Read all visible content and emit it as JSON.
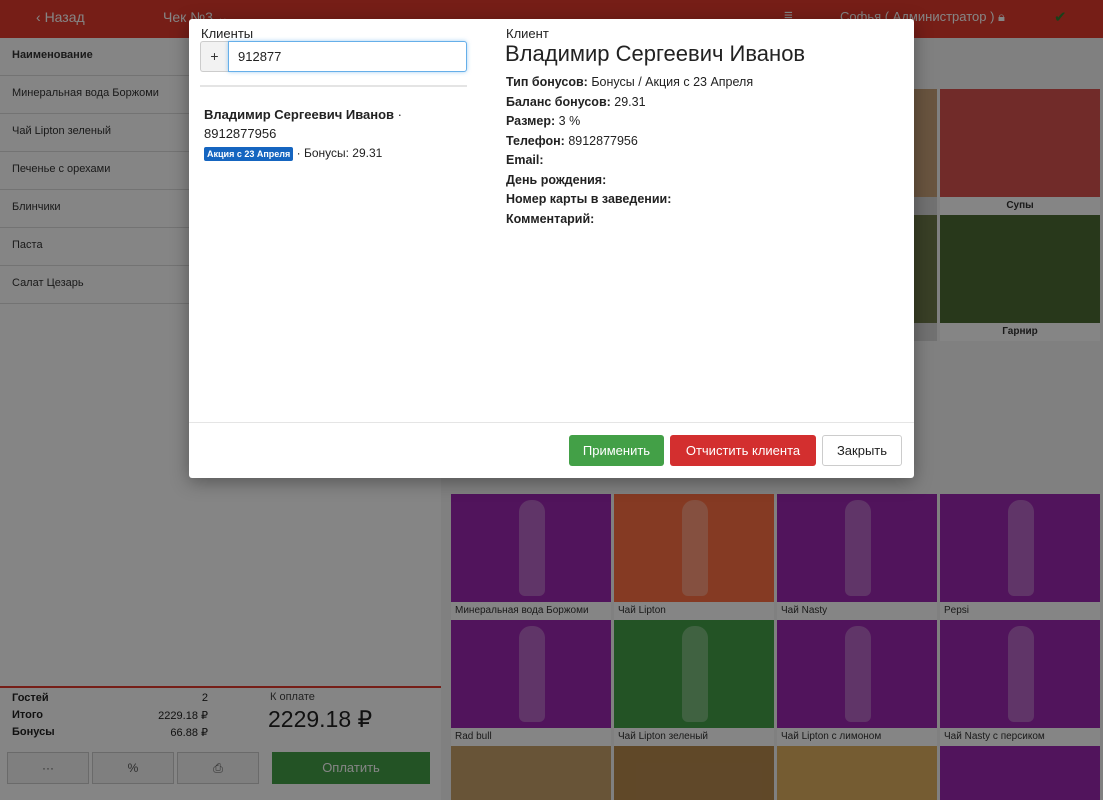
{
  "topbar": {
    "back_label": "Назад",
    "check_label": "Чек №3",
    "user_label": "Софья ( Администратор )"
  },
  "order": {
    "header": "Наименование",
    "items": [
      "Минеральная вода Боржоми",
      "Чай Lipton зеленый",
      "Печенье с орехами",
      "Блинчики",
      "Паста",
      "Салат Цезарь"
    ]
  },
  "totals": {
    "guests_label": "Гостей",
    "guests_value": "2",
    "total_label": "Итого",
    "total_value": "2229.18 ₽",
    "bonus_label": "Бонусы",
    "bonus_value": "66.88 ₽",
    "pay_label": "К оплате",
    "pay_value": "2229.18 ₽",
    "more_label": "···",
    "discount_label": "%",
    "pay_button": "Оплатить"
  },
  "categories": [
    {
      "label": "Супы"
    },
    {
      "label": "Гарнир"
    }
  ],
  "products": [
    {
      "label": "Минеральная вода Боржоми",
      "color": "#9c27b0"
    },
    {
      "label": "Чай Lipton",
      "color": "#ff7043"
    },
    {
      "label": "Чай Nasty",
      "color": "#9c27b0"
    },
    {
      "label": "Pepsi",
      "color": "#9c27b0"
    },
    {
      "label": "Rad bull",
      "color": "#9c27b0"
    },
    {
      "label": "Чай Lipton зеленый",
      "color": "#43a047"
    },
    {
      "label": "Чай Lipton с лимоном",
      "color": "#9c27b0"
    },
    {
      "label": "Чай Nasty с персиком",
      "color": "#9c27b0"
    }
  ],
  "modal": {
    "clients_title": "Клиенты",
    "plus_label": "+",
    "search_value": "912877",
    "result": {
      "name": "Владимир Сергеевич Иванов",
      "phone": "8912877956",
      "badge": "Акция с 23 Апреля",
      "bonus": "Бонусы: 29.31"
    },
    "client_label": "Клиент",
    "client_name": "Владимир Сергеевич Иванов",
    "fields": [
      {
        "label": "Тип бонусов:",
        "value": "Бонусы / Акция с 23 Апреля"
      },
      {
        "label": "Баланс бонусов:",
        "value": "29.31"
      },
      {
        "label": "Размер:",
        "value": "3 %"
      },
      {
        "label": "Телефон:",
        "value": "8912877956"
      },
      {
        "label": "Email:",
        "value": ""
      },
      {
        "label": "День рождения:",
        "value": ""
      },
      {
        "label": "Номер карты в заведении:",
        "value": ""
      },
      {
        "label": "Комментарий:",
        "value": ""
      }
    ],
    "apply_label": "Применить",
    "clear_label": "Отчистить клиента",
    "close_label": "Закрыть"
  }
}
